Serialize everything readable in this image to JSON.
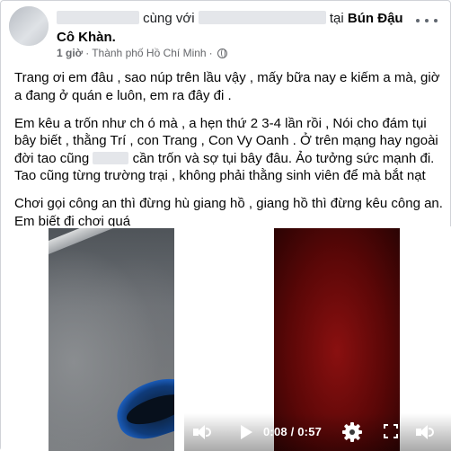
{
  "post": {
    "header": {
      "with_text": "cùng với",
      "at_text": "tại",
      "place": "Bún Đậu",
      "place_line2": "Cô Khàn.",
      "time": "1 giờ",
      "separator": "·",
      "location": "Thành phố Hồ Chí Minh",
      "separator2": "·",
      "privacy_icon": "globe-icon"
    },
    "paragraphs": [
      "Trang ơi em đâu , sao núp trên lầu vậy , mấy bữa nay e kiếm a mà, giờ a đang ở quán e luôn, em ra đây đi .",
      "Em kêu a trốn như ch ó mà , a hẹn thứ 2 3-4 lần rồi , Nói cho đám tụi bây biết , thằng Trí , con Trang , Con Vy Oanh . Ở trên mạng hay ngoài đời tao cũng",
      "cần trốn  và sợ tụi bây đâu. Ảo tưởng sức mạnh đi.",
      "Tao cũng từng trường trại , không phải thằng sinh viên để mà bắt nạt",
      "Chơi gọi công an thì đừng hù giang hồ , giang hồ thì đừng kêu công an. Em biết đi chơi quá"
    ],
    "video": {
      "time": "0:08 / 0:57",
      "icons": [
        "volume-icon",
        "play-icon",
        "gear-icon",
        "fullscreen-icon",
        "volume-icon"
      ]
    },
    "colors": {
      "text": "#050505",
      "muted": "#65676b",
      "redaction": "#e4e6ea",
      "video_red": "#8a1010"
    }
  }
}
